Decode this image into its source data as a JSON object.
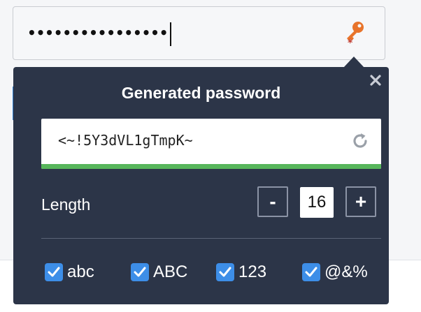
{
  "password_field": {
    "masked_value": "••••••••••••••••",
    "key_icon": "password-key-icon",
    "key_color": "#e8742b"
  },
  "popup": {
    "title": "Generated password",
    "generated_password": "<~!5Y3dVL1gTmpK~",
    "strength_color": "#57b65b",
    "strength_fraction": 1.0,
    "length_label": "Length",
    "length_value": "16",
    "minus_label": "-",
    "plus_label": "+",
    "options": [
      {
        "label": "abc",
        "checked": true
      },
      {
        "label": "ABC",
        "checked": true
      },
      {
        "label": "123",
        "checked": true
      },
      {
        "label": "@&%",
        "checked": true
      }
    ],
    "background_color": "#2c3548",
    "checkbox_color": "#3d8ee8"
  }
}
